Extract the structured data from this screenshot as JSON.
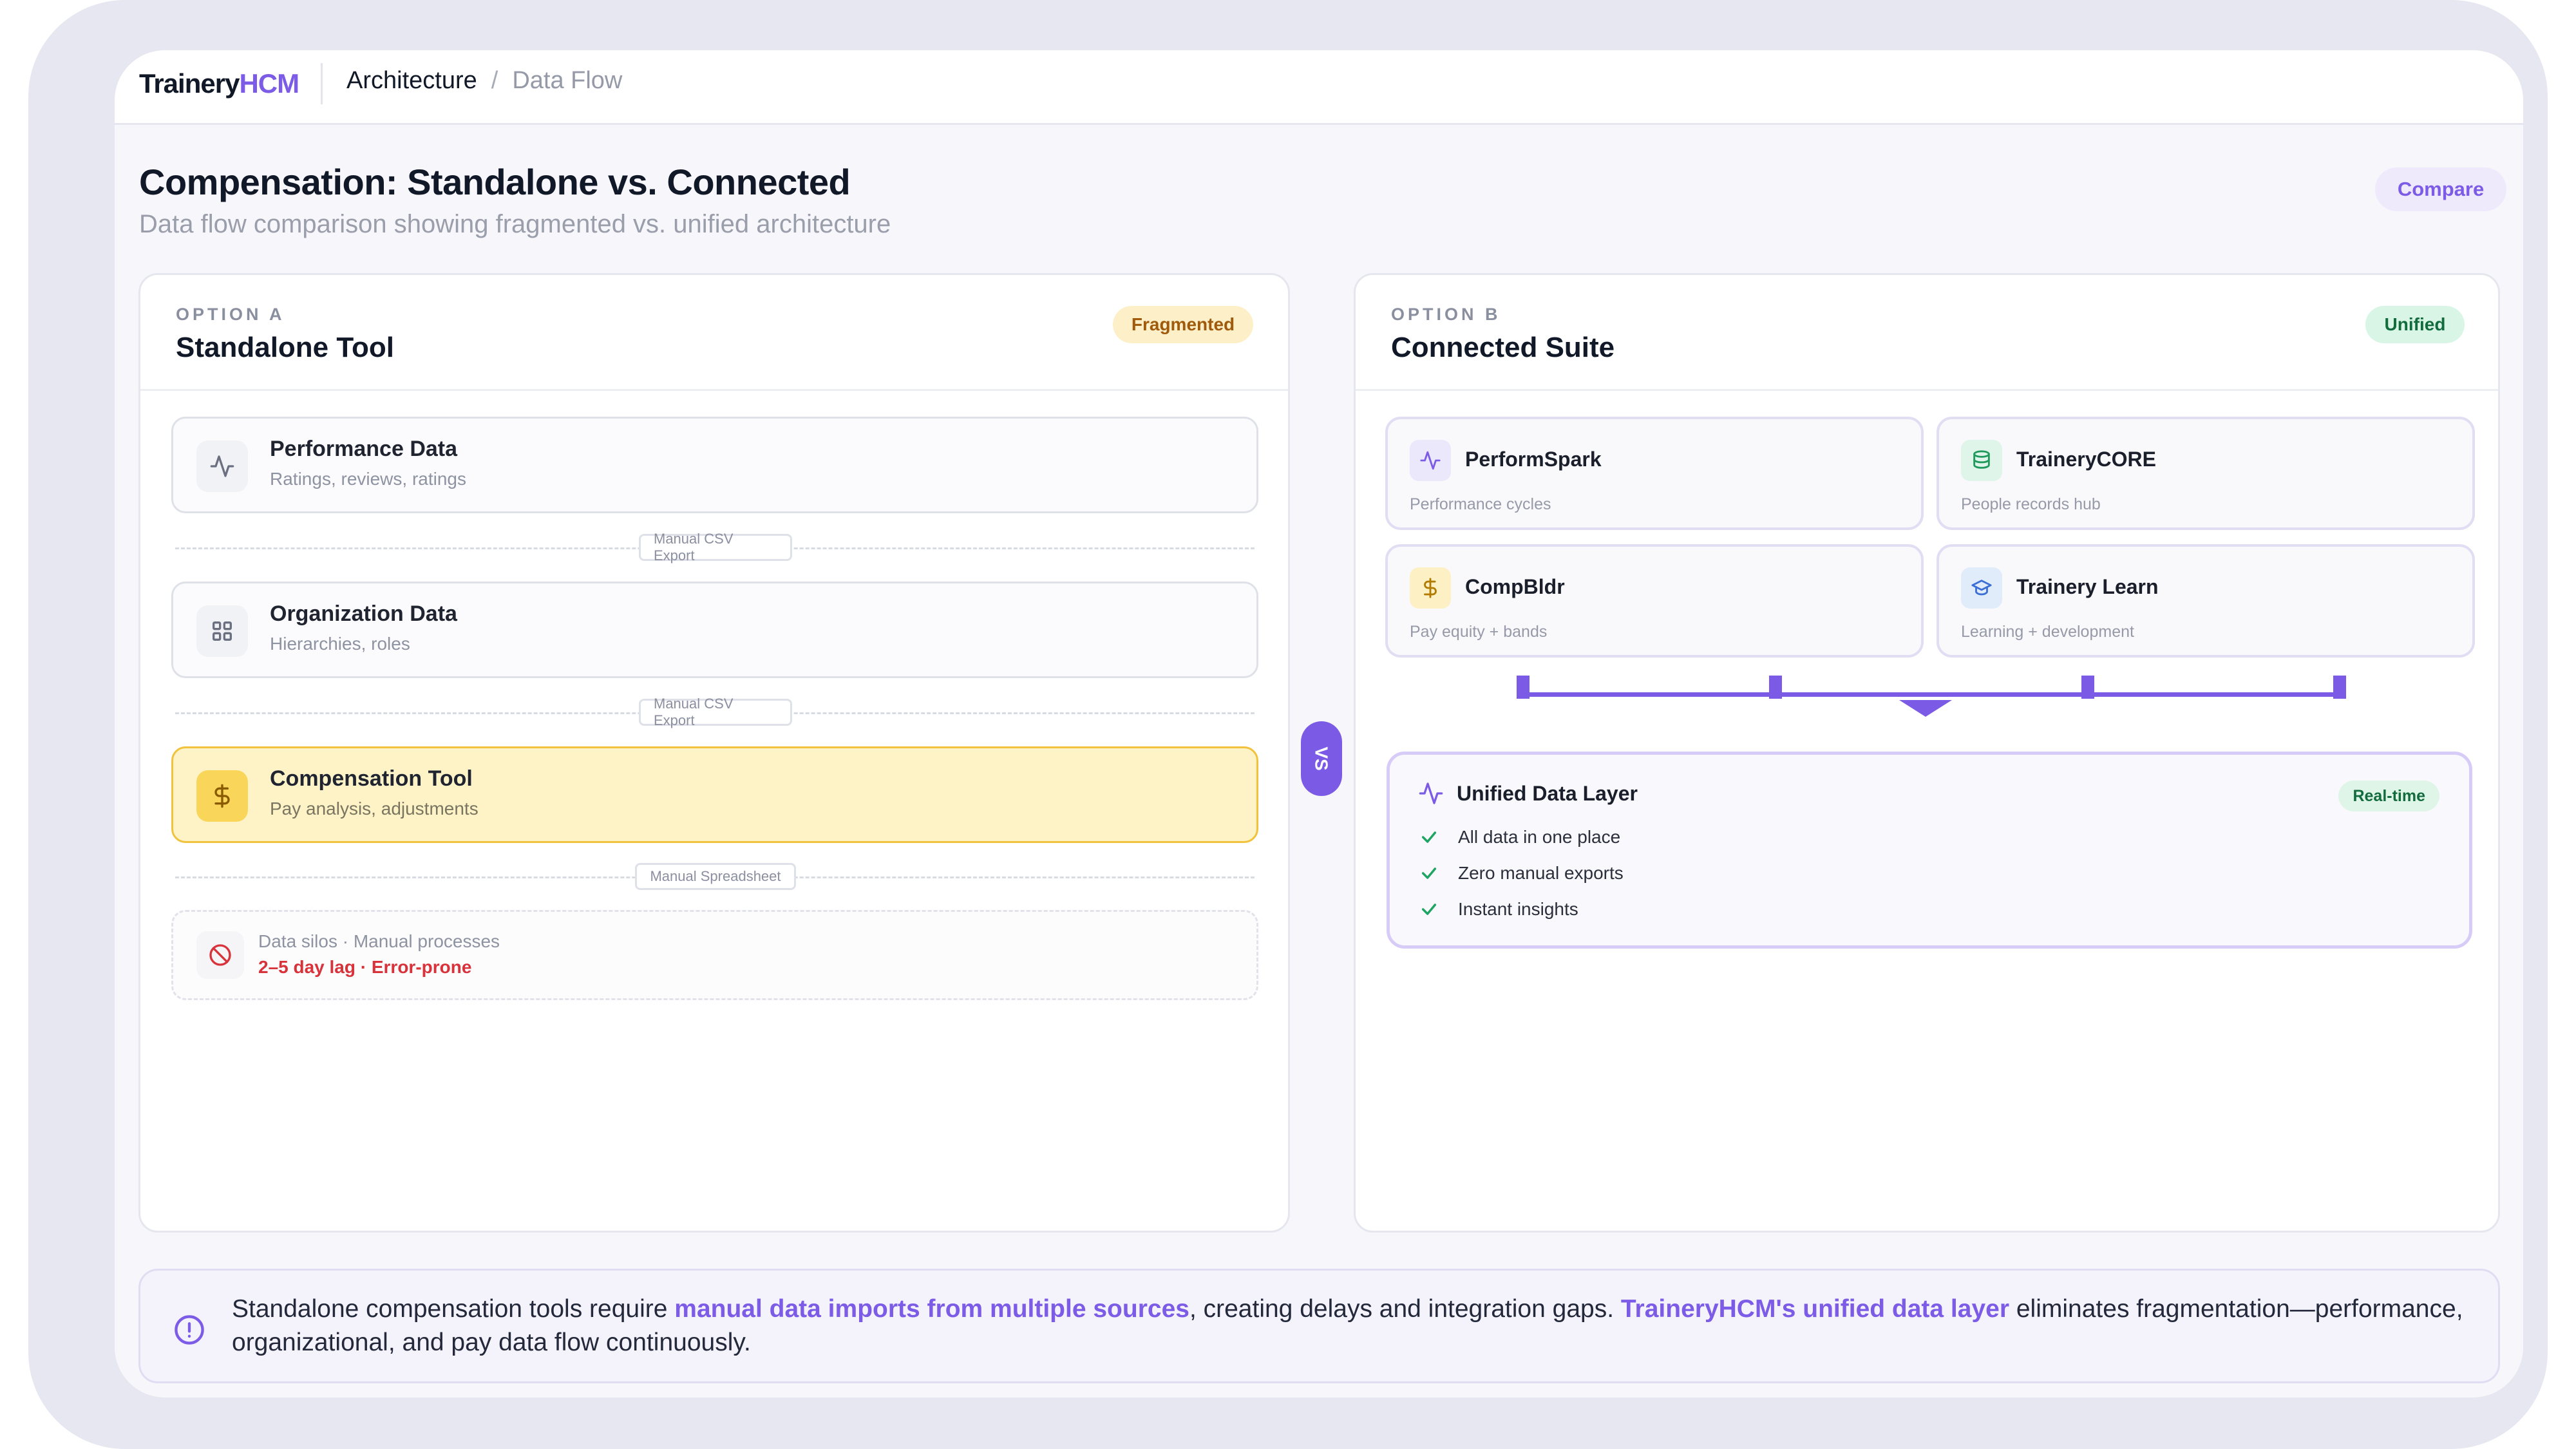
{
  "brand": {
    "part1": "Trainery",
    "part2": "HCM"
  },
  "breadcrumb": {
    "current": "Architecture",
    "separator": "/",
    "page": "Data Flow"
  },
  "header": {
    "title": "Compensation: Standalone vs. Connected",
    "subtitle": "Data flow comparison showing fragmented vs. unified architecture",
    "compare_label": "Compare"
  },
  "option_a": {
    "label": "OPTION A",
    "title": "Standalone Tool",
    "badge": "Fragmented",
    "cards": [
      {
        "title": "Performance Data",
        "subtitle": "Ratings, reviews, ratings",
        "icon": "activity-icon"
      },
      {
        "title": "Organization Data",
        "subtitle": "Hierarchies, roles",
        "icon": "grid-icon"
      },
      {
        "title": "Compensation Tool",
        "subtitle": "Pay analysis, adjustments",
        "icon": "dollar-icon"
      }
    ],
    "connectors": [
      "Manual CSV Export",
      "Manual CSV Export",
      "Manual Spreadsheet"
    ],
    "warning": {
      "line1": "Data silos · Manual processes",
      "line2": "2–5 day lag · Error-prone",
      "icon": "ban-icon"
    }
  },
  "vs_label": "VS",
  "option_b": {
    "label": "OPTION B",
    "title": "Connected Suite",
    "badge": "Unified",
    "modules": [
      {
        "title": "PerformSpark",
        "subtitle": "Performance cycles",
        "icon": "activity-icon"
      },
      {
        "title": "TraineryCORE",
        "subtitle": "People records hub",
        "icon": "database-icon"
      },
      {
        "title": "CompBldr",
        "subtitle": "Pay equity + bands",
        "icon": "dollar-icon"
      },
      {
        "title": "Trainery Learn",
        "subtitle": "Learning + development",
        "icon": "graduation-cap-icon"
      }
    ],
    "data_layer": {
      "title": "Unified Data Layer",
      "badge": "Real-time",
      "features": [
        "All data in one place",
        "Zero manual exports",
        "Instant insights"
      ]
    }
  },
  "footer_note": {
    "t1": "Standalone compensation tools require ",
    "h1": "manual data imports from multiple sources",
    "t2": ", creating delays and integration gaps. ",
    "h2": "TraineryHCM's unified data layer",
    "t3": " eliminates fragmentation—performance, organizational, and pay data flow continuously."
  },
  "colors": {
    "accent": "#7c5ce6",
    "warning_bg": "#fdf3c6",
    "success": "#136c3e",
    "error": "#d8323a"
  }
}
